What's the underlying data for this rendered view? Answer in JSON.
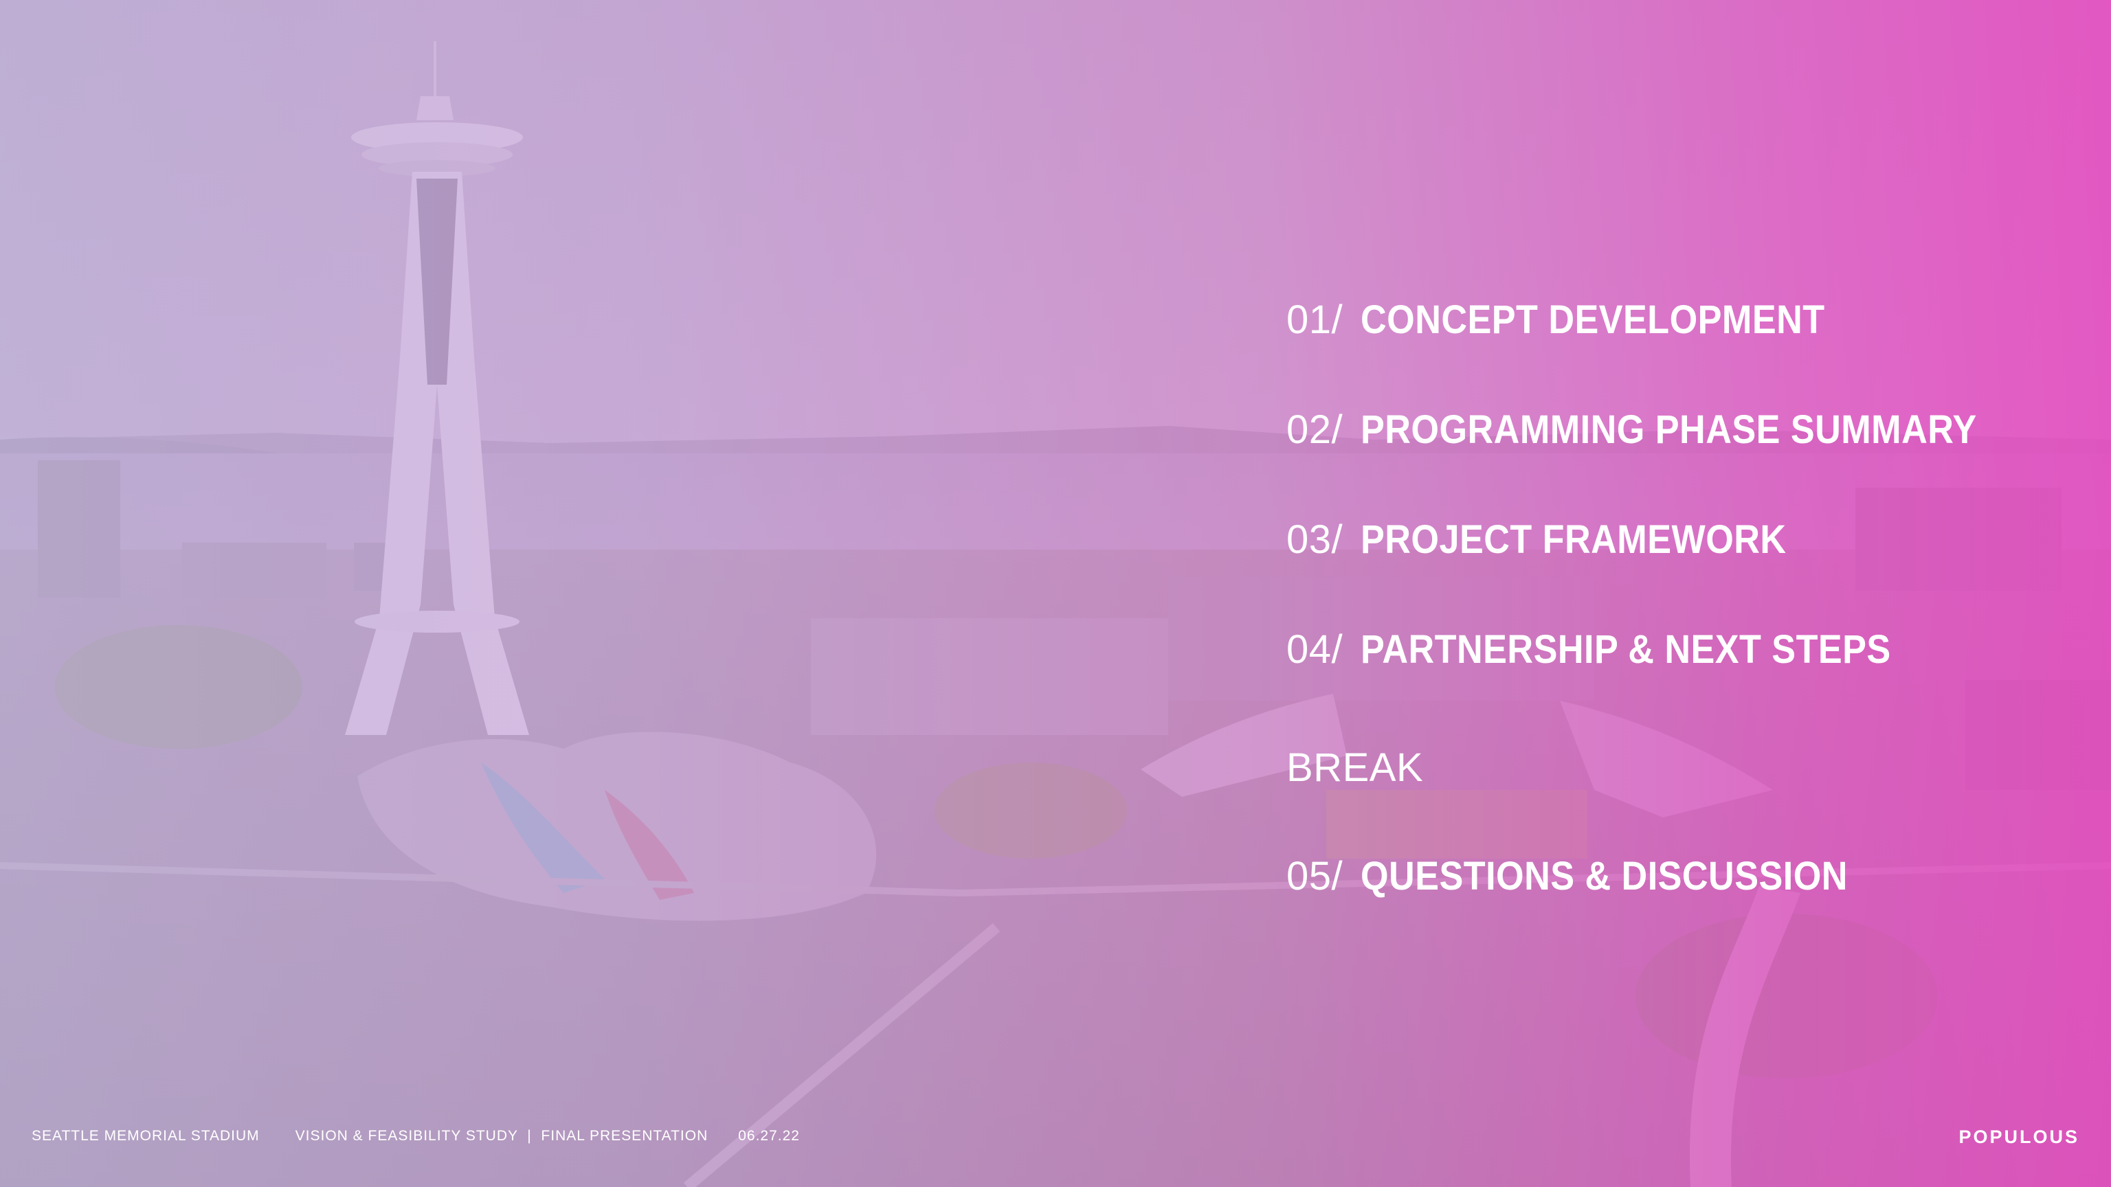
{
  "agenda": [
    {
      "number": "01/",
      "title": "CONCEPT DEVELOPMENT"
    },
    {
      "number": "02/",
      "title": "PROGRAMMING PHASE SUMMARY"
    },
    {
      "number": "03/",
      "title": "PROJECT FRAMEWORK"
    },
    {
      "number": "04/",
      "title": "PARTNERSHIP & NEXT STEPS"
    },
    {
      "break_label": "BREAK"
    },
    {
      "number": "05/",
      "title": "QUESTIONS & DISCUSSION"
    }
  ],
  "footer": {
    "project": "SEATTLE MEMORIAL STADIUM",
    "study": "VISION & FEASIBILITY STUDY  |  FINAL PRESENTATION",
    "date": "06.27.22"
  },
  "logo": {
    "text": "POPULOUS"
  },
  "colors": {
    "overlay_left": "#c4b4dc",
    "overlay_right": "#e850c3",
    "text": "#ffffff"
  }
}
